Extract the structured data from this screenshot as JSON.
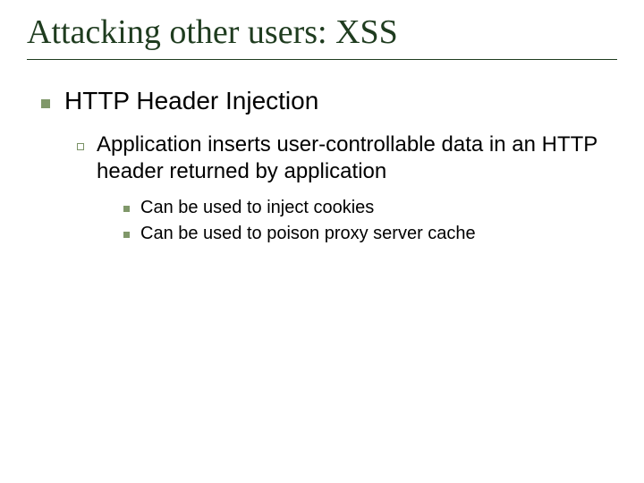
{
  "title": "Attacking other users: XSS",
  "lvl1": "HTTP Header Injection",
  "lvl2": "Application inserts user-controllable data in an HTTP header returned by application",
  "lvl3a": "Can be used to inject cookies",
  "lvl3b": "Can be used to poison proxy server cache"
}
